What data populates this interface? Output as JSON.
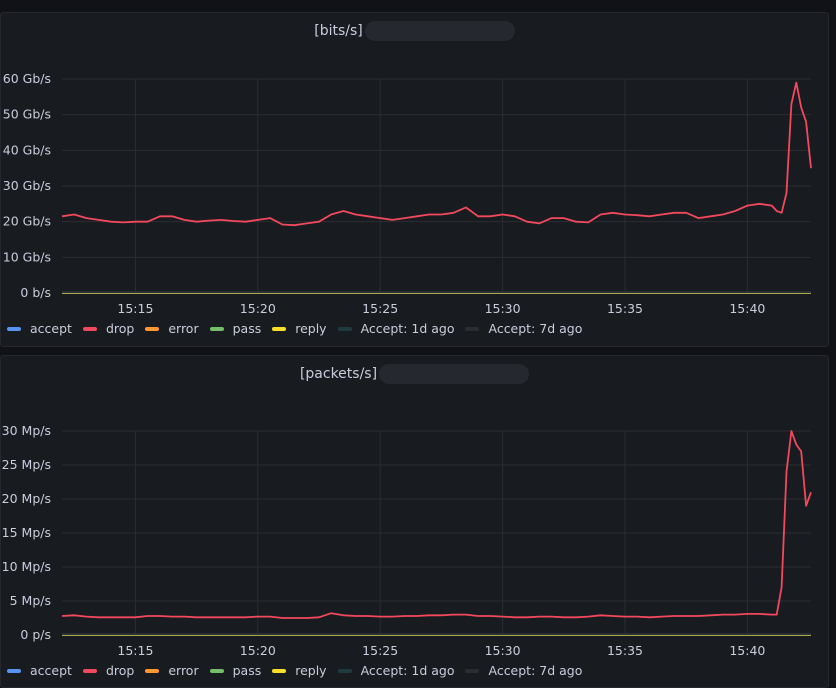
{
  "panels": [
    {
      "title": "[bits/s]",
      "legend": [
        {
          "label": "accept",
          "color": "#5794f2"
        },
        {
          "label": "drop",
          "color": "#f2495c"
        },
        {
          "label": "error",
          "color": "#ff9830"
        },
        {
          "label": "pass",
          "color": "#73bf69"
        },
        {
          "label": "reply",
          "color": "#fade2a"
        },
        {
          "label": "Accept: 1d ago",
          "color": "#1f3a3f"
        },
        {
          "label": "Accept: 7d ago",
          "color": "#2a2d33"
        }
      ]
    },
    {
      "title": "[packets/s]",
      "legend": [
        {
          "label": "accept",
          "color": "#5794f2"
        },
        {
          "label": "drop",
          "color": "#f2495c"
        },
        {
          "label": "error",
          "color": "#ff9830"
        },
        {
          "label": "pass",
          "color": "#73bf69"
        },
        {
          "label": "reply",
          "color": "#fade2a"
        },
        {
          "label": "Accept: 1d ago",
          "color": "#1f3a3f"
        },
        {
          "label": "Accept: 7d ago",
          "color": "#2a2d33"
        }
      ]
    }
  ],
  "chart_data": [
    {
      "type": "line",
      "title": "[bits/s]",
      "x_ticks": [
        "15:15",
        "15:20",
        "15:25",
        "15:30",
        "15:35",
        "15:40"
      ],
      "x_tick_minutes": [
        15,
        20,
        25,
        30,
        35,
        40
      ],
      "x_range_minutes": [
        12.0,
        42.6
      ],
      "y_ticks": [
        "0 b/s",
        "10 Gb/s",
        "20 Gb/s",
        "30 Gb/s",
        "40 Gb/s",
        "50 Gb/s",
        "60 Gb/s"
      ],
      "ylim": [
        0,
        60
      ],
      "y_unit": "Gb/s",
      "grid": true,
      "legend_position": "bottom",
      "series": [
        {
          "name": "drop",
          "color": "#f2495c",
          "x_minutes": [
            12.0,
            12.5,
            13.0,
            13.5,
            14.0,
            14.5,
            15.0,
            15.5,
            16.0,
            16.5,
            17.0,
            17.5,
            18.0,
            18.5,
            19.0,
            19.5,
            20.0,
            20.5,
            21.0,
            21.5,
            22.0,
            22.5,
            23.0,
            23.5,
            24.0,
            24.5,
            25.0,
            25.5,
            26.0,
            26.5,
            27.0,
            27.5,
            28.0,
            28.5,
            29.0,
            29.5,
            30.0,
            30.5,
            31.0,
            31.5,
            32.0,
            32.5,
            33.0,
            33.5,
            34.0,
            34.5,
            35.0,
            35.5,
            36.0,
            36.5,
            37.0,
            37.5,
            38.0,
            38.5,
            39.0,
            39.5,
            40.0,
            40.5,
            41.0,
            41.2,
            41.4,
            41.6,
            41.8,
            42.0,
            42.2,
            42.4,
            42.6
          ],
          "values": [
            21.5,
            22,
            21,
            20.5,
            20,
            19.8,
            20,
            20,
            21.5,
            21.5,
            20.5,
            20,
            20.3,
            20.5,
            20.2,
            20,
            20.5,
            21,
            19.2,
            19,
            19.5,
            20,
            22,
            23,
            22,
            21.5,
            21,
            20.5,
            21,
            21.5,
            22,
            22,
            22.5,
            24,
            21.5,
            21.5,
            22,
            21.5,
            20,
            19.5,
            21,
            21,
            20,
            19.8,
            22,
            22.5,
            22,
            21.8,
            21.5,
            22,
            22.5,
            22.5,
            21,
            21.5,
            22,
            23,
            24.5,
            25,
            24.5,
            23,
            22.5,
            28,
            53,
            59,
            52,
            48,
            35
          ]
        },
        {
          "name": "accept",
          "color": "#5794f2",
          "values": "~0"
        },
        {
          "name": "error",
          "color": "#ff9830",
          "values": "~0"
        },
        {
          "name": "pass",
          "color": "#73bf69",
          "values": "~0"
        },
        {
          "name": "reply",
          "color": "#fade2a",
          "values": "~0"
        },
        {
          "name": "Accept: 1d ago",
          "color": "#1f3a3f",
          "values": "~0"
        },
        {
          "name": "Accept: 7d ago",
          "color": "#2a2d33",
          "values": "~0"
        }
      ]
    },
    {
      "type": "line",
      "title": "[packets/s]",
      "x_ticks": [
        "15:15",
        "15:20",
        "15:25",
        "15:30",
        "15:35",
        "15:40"
      ],
      "x_tick_minutes": [
        15,
        20,
        25,
        30,
        35,
        40
      ],
      "x_range_minutes": [
        12.0,
        42.6
      ],
      "y_ticks": [
        "0 p/s",
        "5 Mp/s",
        "10 Mp/s",
        "15 Mp/s",
        "20 Mp/s",
        "25 Mp/s",
        "30 Mp/s"
      ],
      "ylim": [
        0,
        30
      ],
      "y_unit": "Mp/s",
      "grid": true,
      "legend_position": "bottom",
      "series": [
        {
          "name": "drop",
          "color": "#f2495c",
          "x_minutes": [
            12.0,
            12.5,
            13.0,
            13.5,
            14.0,
            14.5,
            15.0,
            15.5,
            16.0,
            16.5,
            17.0,
            17.5,
            18.0,
            18.5,
            19.0,
            19.5,
            20.0,
            20.5,
            21.0,
            21.5,
            22.0,
            22.5,
            23.0,
            23.5,
            24.0,
            24.5,
            25.0,
            25.5,
            26.0,
            26.5,
            27.0,
            27.5,
            28.0,
            28.5,
            29.0,
            29.5,
            30.0,
            30.5,
            31.0,
            31.5,
            32.0,
            32.5,
            33.0,
            33.5,
            34.0,
            34.5,
            35.0,
            35.5,
            36.0,
            36.5,
            37.0,
            37.5,
            38.0,
            38.5,
            39.0,
            39.5,
            40.0,
            40.5,
            41.0,
            41.2,
            41.4,
            41.6,
            41.8,
            42.0,
            42.2,
            42.4,
            42.6
          ],
          "values": [
            2.8,
            2.9,
            2.7,
            2.6,
            2.6,
            2.6,
            2.6,
            2.8,
            2.8,
            2.7,
            2.7,
            2.6,
            2.6,
            2.6,
            2.6,
            2.6,
            2.7,
            2.7,
            2.5,
            2.5,
            2.5,
            2.6,
            3.2,
            2.9,
            2.8,
            2.8,
            2.7,
            2.7,
            2.8,
            2.8,
            2.9,
            2.9,
            3.0,
            3.0,
            2.8,
            2.8,
            2.7,
            2.6,
            2.6,
            2.7,
            2.7,
            2.6,
            2.6,
            2.7,
            2.9,
            2.8,
            2.7,
            2.7,
            2.6,
            2.7,
            2.8,
            2.8,
            2.8,
            2.9,
            3.0,
            3.0,
            3.1,
            3.1,
            3.0,
            3.0,
            7,
            24,
            30,
            28,
            27,
            19,
            21
          ]
        },
        {
          "name": "accept",
          "color": "#5794f2",
          "values": "~0"
        },
        {
          "name": "error",
          "color": "#ff9830",
          "values": "~0"
        },
        {
          "name": "pass",
          "color": "#73bf69",
          "values": "~0"
        },
        {
          "name": "reply",
          "color": "#fade2a",
          "values": "~0"
        },
        {
          "name": "Accept: 1d ago",
          "color": "#1f3a3f",
          "values": "~0"
        },
        {
          "name": "Accept: 7d ago",
          "color": "#2a2d33",
          "values": "~0"
        }
      ]
    }
  ]
}
